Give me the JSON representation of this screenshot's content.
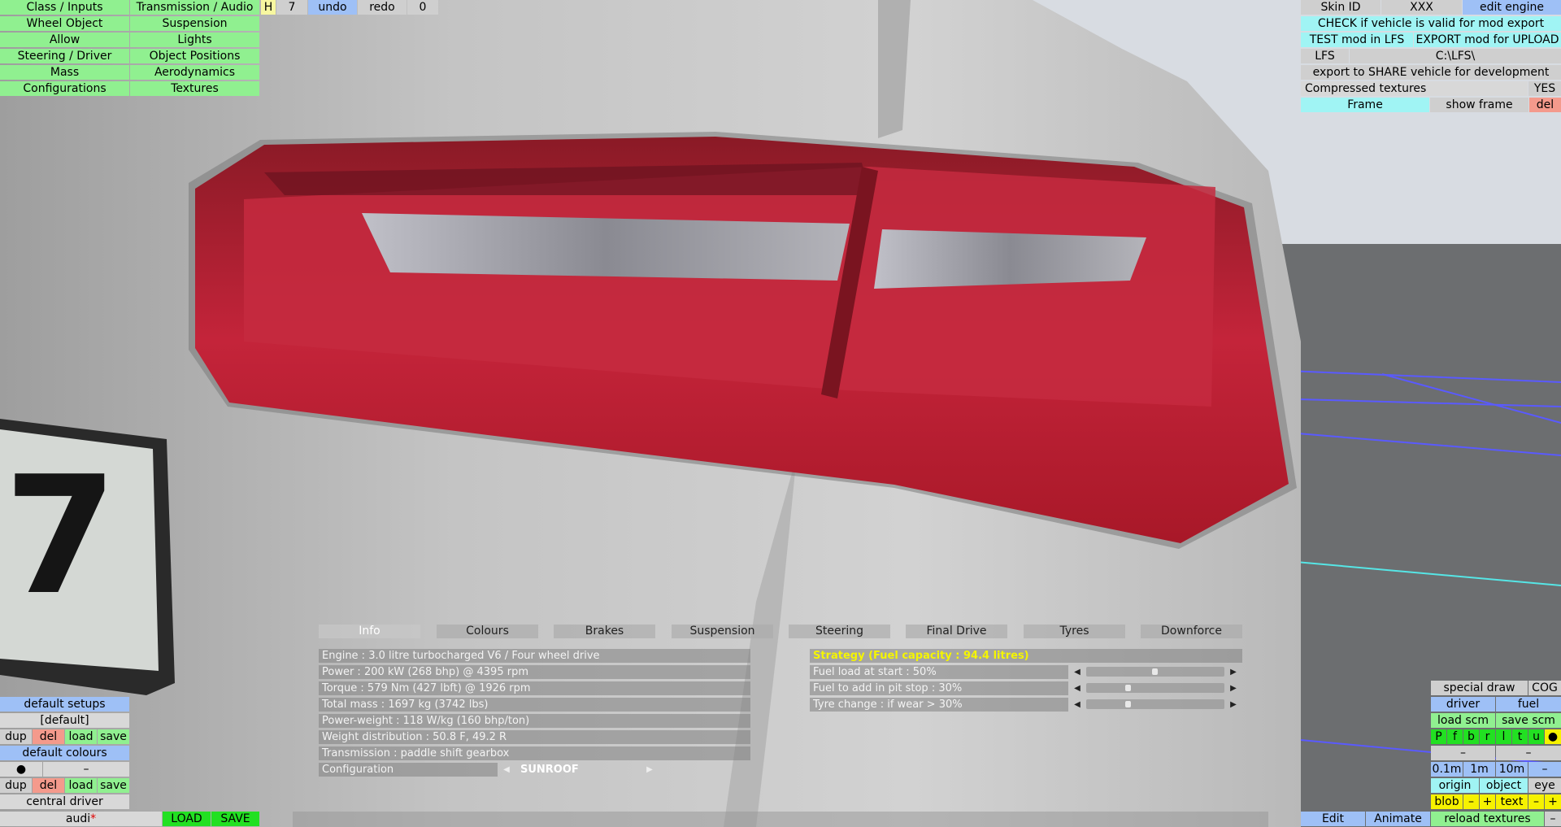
{
  "top_left_menu": {
    "col1": [
      "Class / Inputs",
      "Wheel Object",
      "Allow",
      "Steering / Driver",
      "Mass",
      "Configurations"
    ],
    "col2": [
      "Transmission / Audio",
      "Suspension",
      "Lights",
      "Object Positions",
      "Aerodynamics",
      "Textures"
    ]
  },
  "top_toolbar": {
    "h_label": "H",
    "count": "7",
    "undo": "undo",
    "redo": "redo",
    "zero": "0"
  },
  "top_right": {
    "skin_id_label": "Skin ID",
    "skin_id_value": "XXX",
    "edit_engine": "edit engine",
    "check_valid": "CHECK if vehicle is valid for mod export",
    "test_mod": "TEST mod in LFS",
    "export_mod": "EXPORT mod for UPLOAD",
    "lfs_label": "LFS",
    "lfs_path": "C:\\LFS\\",
    "export_share": "export to SHARE vehicle for development",
    "compressed_label": "Compressed textures",
    "compressed_value": "YES",
    "frame": "Frame",
    "show_frame": "show frame",
    "del": "del"
  },
  "info_panel": {
    "tabs": [
      "Info",
      "Colours",
      "Brakes",
      "Suspension",
      "Steering",
      "Final Drive",
      "Tyres",
      "Downforce"
    ],
    "rows": [
      "Engine : 3.0 litre turbocharged V6 / Four wheel drive",
      "Power : 200 kW (268 bhp) @ 4395 rpm",
      "Torque : 579 Nm (427 lbft) @ 1926 rpm",
      "Total mass : 1697 kg (3742 lbs)",
      "Power-weight : 118 W/kg (160 bhp/ton)",
      "Weight distribution : 50.8 F, 49.2 R",
      "Transmission : paddle shift gearbox"
    ],
    "config_label": "Configuration",
    "config_value": "SUNROOF",
    "strategy_title": "Strategy (Fuel capacity : 94.4 litres)",
    "strategy_rows": [
      {
        "label": "Fuel load at start : 50%",
        "level": 0.5
      },
      {
        "label": "Fuel to add in pit stop : 30%",
        "level": 0.3
      },
      {
        "label": "Tyre change : if wear > 30%",
        "level": 0.3
      }
    ]
  },
  "bottom_left": {
    "default_setups": "default setups",
    "default_item": "[default]",
    "dup": "dup",
    "del": "del",
    "load": "load",
    "save": "save",
    "default_colours": "default colours",
    "dot": "●",
    "dash": "–",
    "central_driver": "central driver",
    "vehicle_name": "audi",
    "modified_mark": "*",
    "load_caps": "LOAD",
    "save_caps": "SAVE"
  },
  "bottom_right": {
    "special_draw": "special draw",
    "cog": "COG",
    "driver": "driver",
    "fuel": "fuel",
    "load_scm": "load scm",
    "save_scm": "save scm",
    "letters": [
      "P",
      "f",
      "b",
      "r",
      "l",
      "t",
      "u",
      "●"
    ],
    "dash": "–",
    "d01": "0.1m",
    "d1": "1m",
    "d10": "10m",
    "origin": "origin",
    "object": "object",
    "eye": "eye",
    "blob": "blob",
    "minus": "–",
    "plus": "+",
    "text": "text",
    "edit": "Edit",
    "animate": "Animate",
    "reload_textures": "reload textures"
  },
  "scene": {
    "plate_char": "7",
    "colors": {
      "body": "#c8c8c8",
      "light_red": "#b8202e",
      "ground": "#6e7072"
    }
  }
}
